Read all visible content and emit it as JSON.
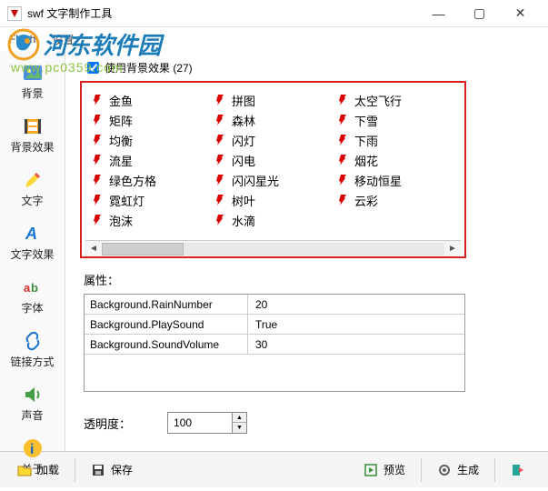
{
  "window": {
    "title": "swf 文字制作工具",
    "min": "—",
    "max": "▢",
    "close": "✕"
  },
  "menu": {
    "flash": "Flash",
    "settings": "设置"
  },
  "watermark": {
    "site": "河东软件园",
    "url": "www.pc0359.com"
  },
  "sidebar": [
    {
      "label": "背景",
      "icon": "image-icon"
    },
    {
      "label": "背景效果",
      "icon": "film-icon"
    },
    {
      "label": "文字",
      "icon": "pencil-icon"
    },
    {
      "label": "文字效果",
      "icon": "a-effect-icon"
    },
    {
      "label": "字体",
      "icon": "font-icon"
    },
    {
      "label": "链接方式",
      "icon": "link-icon"
    },
    {
      "label": "声音",
      "icon": "speaker-icon"
    },
    {
      "label": "关于",
      "icon": "info-icon"
    }
  ],
  "checkbox": {
    "label": "使用背景效果 (27)",
    "checked": true
  },
  "effects": {
    "col1": [
      "金鱼",
      "矩阵",
      "均衡",
      "流星",
      "绿色方格",
      "霓虹灯",
      "泡沫"
    ],
    "col2": [
      "拼图",
      "森林",
      "闪灯",
      "闪电",
      "闪闪星光",
      "树叶",
      "水滴"
    ],
    "col3": [
      "太空飞行",
      "下雪",
      "下雨",
      "烟花",
      "移动恒星",
      "云彩"
    ]
  },
  "properties": {
    "title": "属性：",
    "rows": [
      {
        "key": "Background.RainNumber",
        "val": "20"
      },
      {
        "key": "Background.PlaySound",
        "val": "True"
      },
      {
        "key": "Background.SoundVolume",
        "val": "30"
      }
    ]
  },
  "opacity": {
    "label": "透明度：",
    "value": "100"
  },
  "footer": {
    "load": "加载",
    "save": "保存",
    "preview": "预览",
    "generate": "生成"
  },
  "scroll": {
    "left": "◄",
    "right": "►"
  }
}
